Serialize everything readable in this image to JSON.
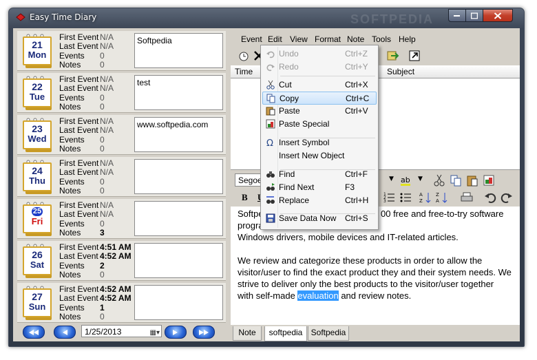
{
  "window": {
    "title": "Easy Time Diary",
    "watermark": "SOFTPEDIA"
  },
  "days": [
    {
      "num": "21",
      "dow": "Mon",
      "today": false,
      "first_label": "First Event",
      "first": "N/A",
      "last_label": "Last Event",
      "last": "N/A",
      "events_label": "Events",
      "events": "0",
      "notes_label": "Notes",
      "notes": "0",
      "note_text": "Softpedia",
      "bold_times": false,
      "bold_events": false,
      "bold_notes": false
    },
    {
      "num": "22",
      "dow": "Tue",
      "today": false,
      "first_label": "First Event",
      "first": "N/A",
      "last_label": "Last Event",
      "last": "N/A",
      "events_label": "Events",
      "events": "0",
      "notes_label": "Notes",
      "notes": "0",
      "note_text": "test",
      "bold_times": false,
      "bold_events": false,
      "bold_notes": false
    },
    {
      "num": "23",
      "dow": "Wed",
      "today": false,
      "first_label": "First Event",
      "first": "N/A",
      "last_label": "Last Event",
      "last": "N/A",
      "events_label": "Events",
      "events": "0",
      "notes_label": "Notes",
      "notes": "0",
      "note_text": "www.softpedia.com",
      "bold_times": false,
      "bold_events": false,
      "bold_notes": false
    },
    {
      "num": "24",
      "dow": "Thu",
      "today": false,
      "first_label": "First Event",
      "first": "N/A",
      "last_label": "Last Event",
      "last": "N/A",
      "events_label": "Events",
      "events": "0",
      "notes_label": "Notes",
      "notes": "0",
      "note_text": "",
      "bold_times": false,
      "bold_events": false,
      "bold_notes": false
    },
    {
      "num": "25",
      "dow": "Fri",
      "today": true,
      "first_label": "First Event",
      "first": "N/A",
      "last_label": "Last Event",
      "last": "N/A",
      "events_label": "Events",
      "events": "0",
      "notes_label": "Notes",
      "notes": "3",
      "note_text": "",
      "bold_times": false,
      "bold_events": false,
      "bold_notes": true
    },
    {
      "num": "26",
      "dow": "Sat",
      "today": false,
      "first_label": "First Event",
      "first": "4:51 AM",
      "last_label": "Last Event",
      "last": "4:52 AM",
      "events_label": "Events",
      "events": "2",
      "notes_label": "Notes",
      "notes": "0",
      "note_text": "",
      "bold_times": true,
      "bold_events": true,
      "bold_notes": false
    },
    {
      "num": "27",
      "dow": "Sun",
      "today": false,
      "first_label": "First Event",
      "first": "4:52 AM",
      "last_label": "Last Event",
      "last": "4:52 AM",
      "events_label": "Events",
      "events": "1",
      "notes_label": "Notes",
      "notes": "0",
      "note_text": "",
      "bold_times": true,
      "bold_events": true,
      "bold_notes": false
    }
  ],
  "nav": {
    "date": "1/25/2013",
    "icons": [
      "rewind-icon",
      "back-icon",
      "forward-icon",
      "fast-forward-icon"
    ]
  },
  "menubar": [
    "Event",
    "Edit",
    "View",
    "Format",
    "Note",
    "Tools",
    "Help"
  ],
  "columns": {
    "time": "Time",
    "subject": "Subject"
  },
  "format": {
    "font": "Segoe",
    "bold": "B",
    "underline": "U"
  },
  "editor": {
    "p1_start": "Softpe",
    "p1_rest_a": "00 free and free-to-try software",
    "p1_line2a": "progra",
    "p1_line3": "Windows drivers, mobile devices and IT-related articles.",
    "p2_line1": "We review and categorize these products in order to allow the",
    "p2_line2": "visitor/user to find the exact product they and their system needs. We",
    "p2_line3": "strive to deliver only the best products to the visitor/user together",
    "p2_line4a": "with self-made ",
    "p2_highlight": "evaluation",
    "p2_line4b": " and review notes."
  },
  "tabs": [
    "Note",
    "softpedia",
    "Softpedia"
  ],
  "active_tab": 1,
  "context_menu": [
    {
      "label": "Undo",
      "key": "Ctrl+Z",
      "disabled": true,
      "icon": "undo-icon"
    },
    {
      "label": "Redo",
      "key": "Ctrl+Y",
      "disabled": true,
      "icon": "redo-icon"
    },
    {
      "label": "Cut",
      "key": "Ctrl+X",
      "disabled": false,
      "icon": "scissors-icon"
    },
    {
      "label": "Copy",
      "key": "Ctrl+C",
      "disabled": false,
      "icon": "copy-icon",
      "selected": true
    },
    {
      "label": "Paste",
      "key": "Ctrl+V",
      "disabled": false,
      "icon": "paste-icon"
    },
    {
      "label": "Paste Special",
      "key": "",
      "disabled": false,
      "icon": "paste-special-icon"
    },
    {
      "label": "Insert Symbol",
      "key": "",
      "disabled": false,
      "icon": "omega-icon"
    },
    {
      "label": "Insert New Object",
      "key": "",
      "disabled": false,
      "icon": ""
    },
    {
      "label": "Find",
      "key": "Ctrl+F",
      "disabled": false,
      "icon": "binoculars-icon"
    },
    {
      "label": "Find Next",
      "key": "F3",
      "disabled": false,
      "icon": "find-next-icon"
    },
    {
      "label": "Replace",
      "key": "Ctrl+H",
      "disabled": false,
      "icon": "replace-icon"
    },
    {
      "label": "Save Data Now",
      "key": "Ctrl+S",
      "disabled": false,
      "icon": "save-icon"
    }
  ],
  "colors": {
    "accent": "#3399ff",
    "calendar_gold": "#d4a52c",
    "calendar_text": "#1a2a7a",
    "today_red": "#d01010"
  }
}
